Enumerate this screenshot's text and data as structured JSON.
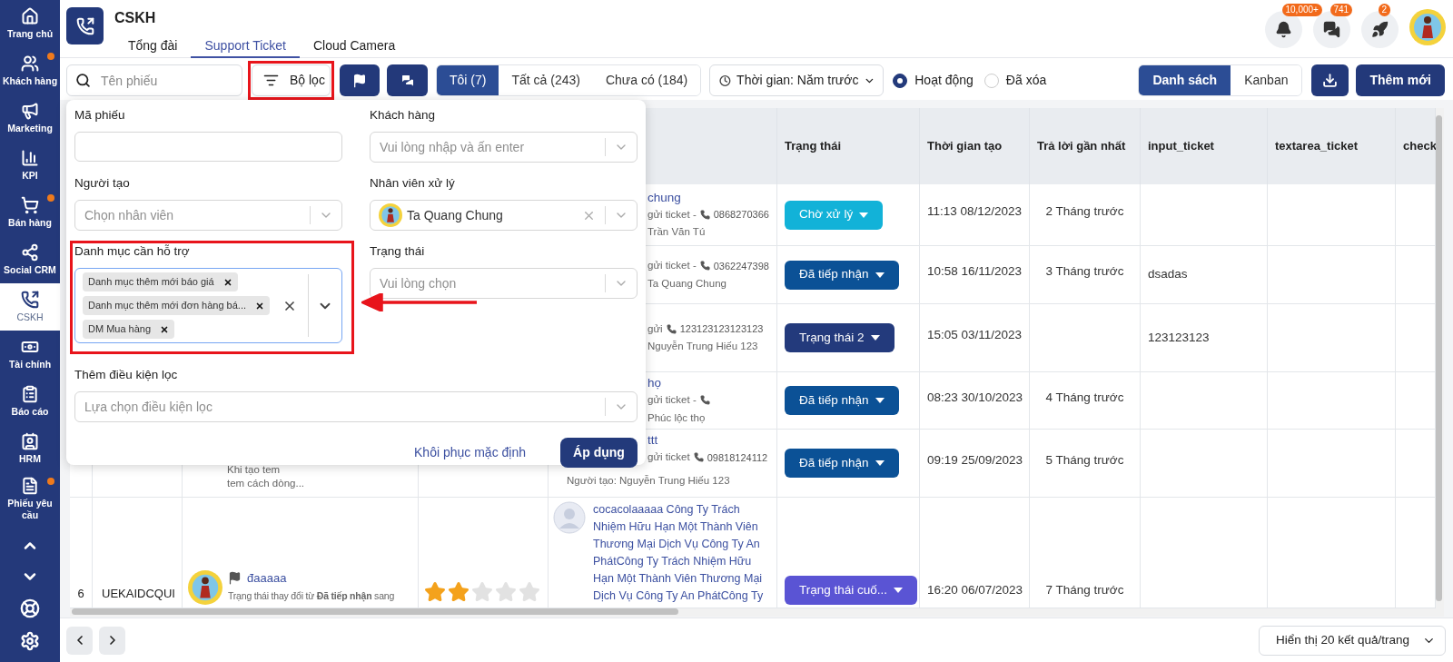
{
  "sidebar": {
    "items": [
      {
        "label": "Trang chủ",
        "selected": false,
        "dot": false
      },
      {
        "label": "Khách hàng",
        "selected": false,
        "dot": true
      },
      {
        "label": "Marketing",
        "selected": false,
        "dot": false
      },
      {
        "label": "KPI",
        "selected": false,
        "dot": false
      },
      {
        "label": "Bán hàng",
        "selected": false,
        "dot": true
      },
      {
        "label": "Social CRM",
        "selected": false,
        "dot": false
      },
      {
        "label": "CSKH",
        "selected": true,
        "dot": false
      },
      {
        "label": "Tài chính",
        "selected": false,
        "dot": false
      },
      {
        "label": "Báo cáo",
        "selected": false,
        "dot": false
      },
      {
        "label": "HRM",
        "selected": false,
        "dot": false
      },
      {
        "label": "Phiếu yêu cầu",
        "selected": false,
        "dot": true
      }
    ]
  },
  "header": {
    "title": "CSKH",
    "tabs": [
      {
        "label": "Tổng đài",
        "selected": false
      },
      {
        "label": "Support Ticket",
        "selected": true
      },
      {
        "label": "Cloud Camera",
        "selected": false
      }
    ],
    "badges": [
      "10,000+",
      "741",
      "2"
    ]
  },
  "toolbar": {
    "search": {
      "placeholder": "Tên phiếu"
    },
    "filter_button": {
      "label": "Bộ lọc",
      "highlighted": true
    },
    "scope_tabs": [
      {
        "label": "Tôi (7)",
        "selected": true
      },
      {
        "label": "Tất cả (243)",
        "selected": false
      },
      {
        "label": "Chưa có (184)",
        "selected": false
      }
    ],
    "time_select": "Thời gian: Năm trước",
    "status_radios": [
      {
        "label": "Hoạt động",
        "selected": true
      },
      {
        "label": "Đã xóa",
        "selected": false
      }
    ],
    "view_tabs": [
      {
        "label": "Danh sách",
        "selected": true
      },
      {
        "label": "Kanban",
        "selected": false
      }
    ],
    "add_button": "Thêm mới"
  },
  "filter_panel": {
    "fields": [
      {
        "kind": "input",
        "label": "Mã phiếu"
      },
      {
        "kind": "select",
        "label": "Khách hàng",
        "placeholder": "Vui lòng nhập và ấn enter"
      },
      {
        "kind": "select",
        "label": "Người tạo",
        "placeholder": "Chọn nhân viên"
      },
      {
        "kind": "user",
        "label": "Nhân viên xử lý",
        "value": "Ta Quang Chung"
      },
      {
        "kind": "tags",
        "label": "Danh mục cần hỗ trợ",
        "tags": [
          "Danh mục thêm mới báo giá",
          "Danh mục thêm mới đơn hàng bá...",
          "DM Mua hàng"
        ],
        "highlighted": true
      },
      {
        "kind": "select",
        "label": "Trạng thái",
        "placeholder": "Vui lòng chọn"
      },
      {
        "kind": "select",
        "label": "Thêm điều kiện lọc",
        "placeholder": "Lựa chọn điều kiện lọc",
        "wide": true
      }
    ],
    "reset_link": "Khôi phục mặc định",
    "apply_button": "Áp dụng"
  },
  "table": {
    "columns": [
      "Trạng thái",
      "Thời gian tạo",
      "Trả lời gần nhất",
      "input_ticket",
      "textarea_ticket",
      "check"
    ],
    "rows": [
      {
        "hidden": true,
        "customer": {
          "name": "chung",
          "line": "gửi ticket -",
          "phone": "0868270366",
          "creator": "Trần Văn Tú"
        },
        "status": {
          "label": "Chờ xử lý",
          "color": "#12b2d8"
        },
        "created": "11:13 08/12/2023",
        "last_reply": "2 Tháng trước"
      },
      {
        "hidden": true,
        "customer": {
          "line": "gửi ticket -",
          "phone": "0362247398",
          "creator": "Ta Quang Chung"
        },
        "status": {
          "label": "Đã tiếp nhận",
          "color": "#0b5196"
        },
        "created": "10:58 16/11/2023",
        "last_reply": "3 Tháng trước",
        "input_ticket": "dsadas"
      },
      {
        "hidden": true,
        "customer": {
          "line": "gửi",
          "phone": "123123123123123",
          "creator": "Nguyễn Trung Hiếu 123"
        },
        "status": {
          "label": "Trạng thái 2",
          "color": "#233a7c"
        },
        "created": "15:05 03/11/2023",
        "input_ticket": "123123123"
      },
      {
        "hidden": true,
        "customer": {
          "name": "họ",
          "line": "gửi ticket -",
          "creator": "Phúc lộc thọ"
        },
        "status": {
          "label": "Đã tiếp nhận",
          "color": "#0b5196"
        },
        "created": "08:23 30/10/2023",
        "last_reply": "4 Tháng trước"
      },
      {
        "hidden_top": true,
        "notes": [
          "Khi tạo tem",
          "tem cách dòng..."
        ],
        "customer": {
          "name": "ttt",
          "line": "gửi ticket",
          "phone": "09818124112",
          "creator": "Người tạo: Nguyễn Trung Hiếu 123"
        },
        "status": {
          "label": "Đã tiếp nhận",
          "color": "#0b5196"
        },
        "created": "09:19 25/09/2023",
        "last_reply": "5 Tháng trước"
      },
      {
        "number": "6",
        "code": "UEKAIDCQUI",
        "title": "đaaaaa",
        "subtitle": "Trạng thái thay đổi từ **Đã tiếp nhận** sang",
        "stars": 2,
        "customer": {
          "name": "cocacolaaaaa Công Ty Trách Nhiệm Hữu Hạn Một Thành Viên Thương Mại Dịch Vụ Công Ty An PhátCông Ty Trách Nhiệm Hữu Hạn Một Thành Viên Thương Mại Dịch Vụ Công Ty An PhátCông Ty"
        },
        "status": {
          "label": "Trạng thái cuố...",
          "color": "#5a54d4"
        },
        "created": "16:20 06/07/2023",
        "last_reply": "7 Tháng trước"
      }
    ]
  },
  "pagination": {
    "page_size": "Hiển thị 20 kết quả/trang"
  }
}
